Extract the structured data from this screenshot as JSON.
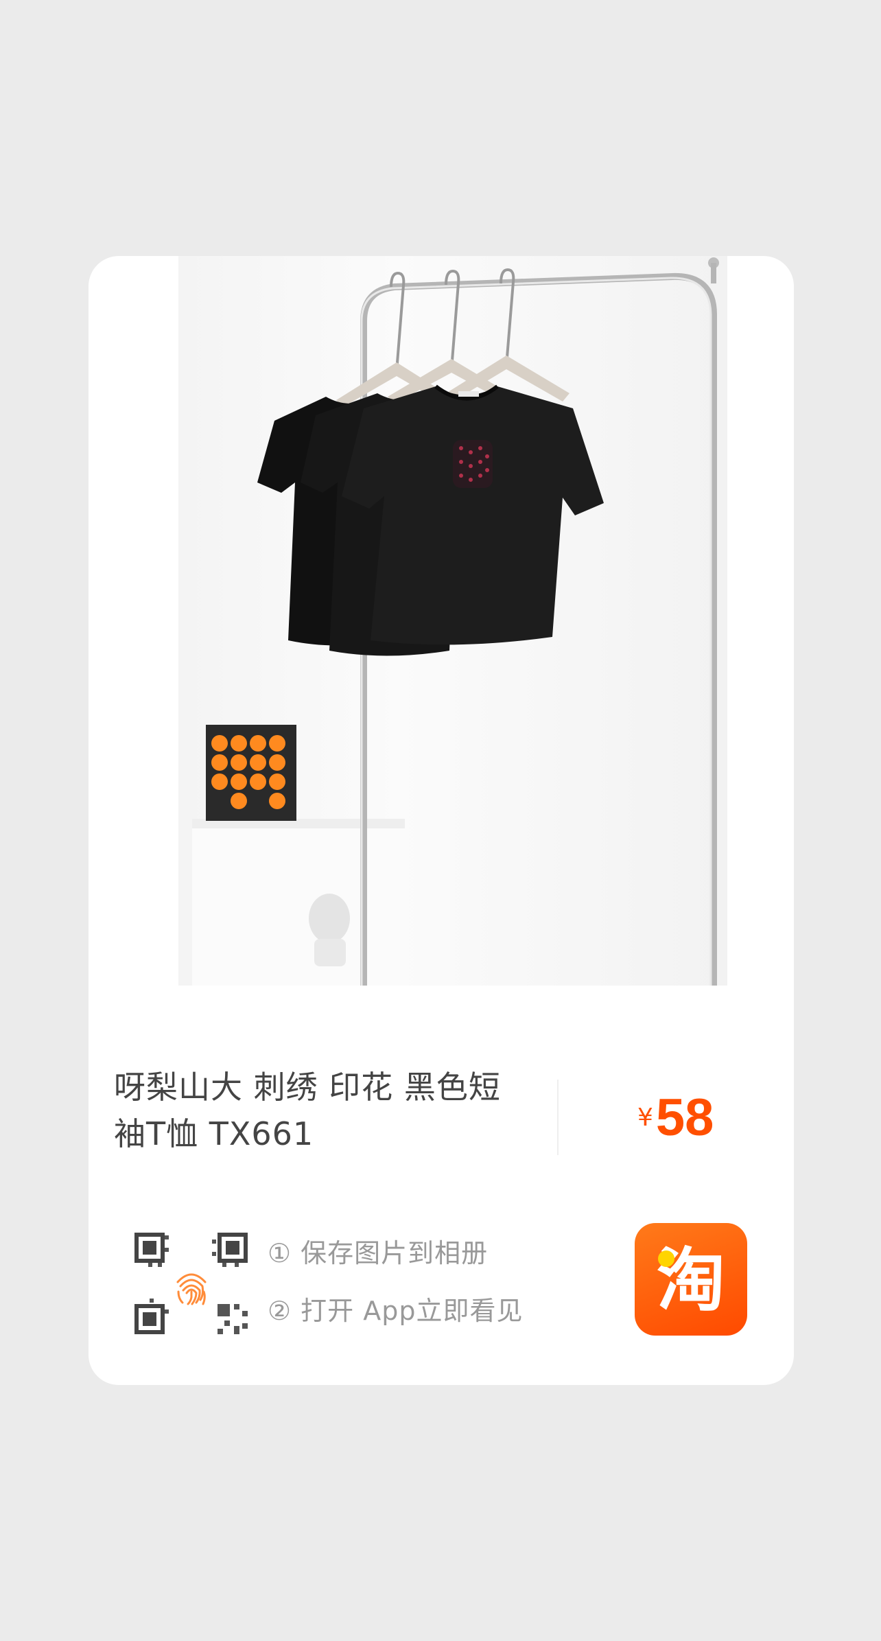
{
  "product": {
    "title_line1": "呀梨山大 刺绣 印花 黑色短",
    "title_line2": "袖T恤 TX661",
    "currency": "¥",
    "price": "58",
    "image_icon": "product-photo-black-tshirts-on-rack"
  },
  "instructions": {
    "step1": "① 保存图片到相册",
    "step2": "② 打开 App立即看见"
  },
  "app": {
    "icon": "taobao-icon",
    "glyph": "淘"
  },
  "colors": {
    "price": "#ff4f00",
    "app_icon": "#ff5a00",
    "page_background": "#ebebeb",
    "card_background": "#ffffff"
  }
}
